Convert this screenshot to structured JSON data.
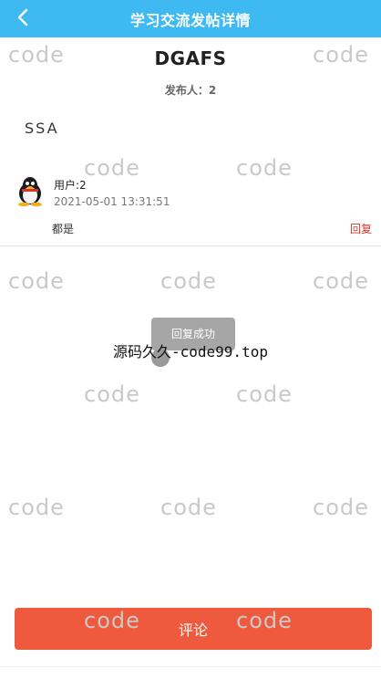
{
  "header": {
    "title": "学习交流发帖详情",
    "back_icon": "chevron-left-icon",
    "background": "#3fb9f2"
  },
  "post": {
    "title": "DGAFS",
    "author": "发布人：2",
    "content": "SSA"
  },
  "comments": [
    {
      "avatar_icon": "penguin-icon",
      "user": "用户:2",
      "time": "2021-05-01 13:31:51",
      "text": "都是",
      "reply_label": "回复"
    }
  ],
  "toast": {
    "message": "回复成功"
  },
  "watermark": {
    "text": "code",
    "site_text": "源码久久-code99.top"
  },
  "footer": {
    "comment_button_label": "评论",
    "button_color": "#ef5a3e"
  }
}
